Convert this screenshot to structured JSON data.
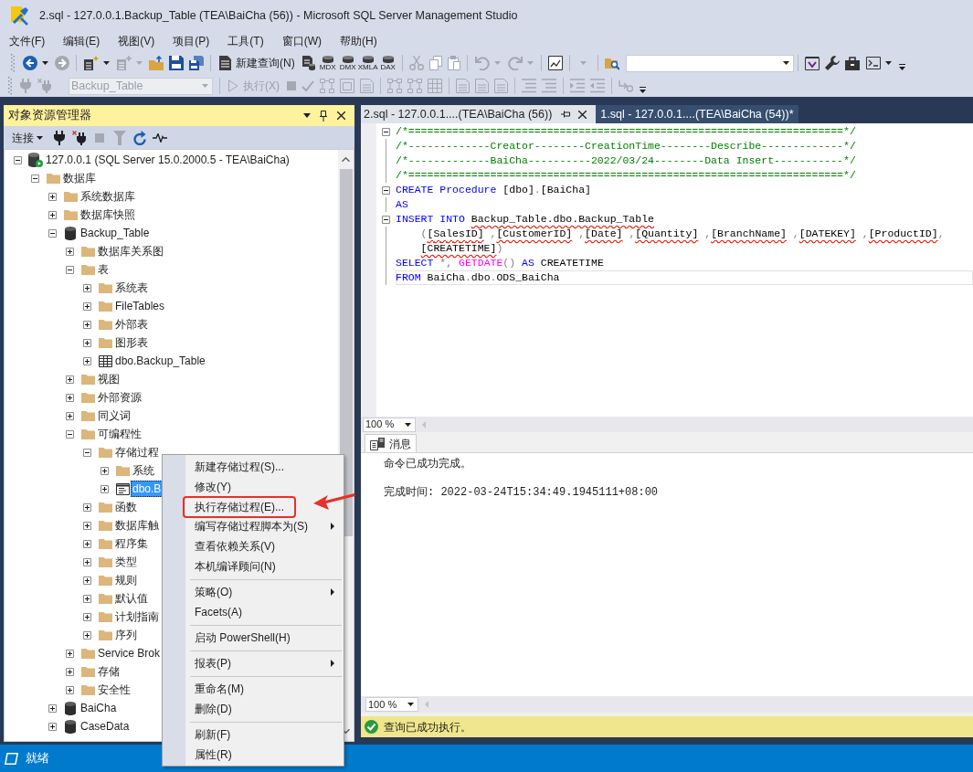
{
  "window": {
    "title": "2.sql - 127.0.0.1.Backup_Table (TEA\\BaiCha (56)) - Microsoft SQL Server Management Studio"
  },
  "menu_bar": [
    "文件(F)",
    "编辑(E)",
    "视图(V)",
    "项目(P)",
    "工具(T)",
    "窗口(W)",
    "帮助(H)"
  ],
  "toolbar_1": [
    {
      "kind": "icon",
      "dropdown": true,
      "disabled": false
    },
    {
      "kind": "icon",
      "dropdown": false,
      "disabled": true
    },
    {
      "kind": "separator"
    },
    {
      "kind": "icon",
      "dropdown": true,
      "disabled": false
    },
    {
      "kind": "icon",
      "dropdown": true,
      "disabled": true
    },
    {
      "kind": "icon",
      "dropdown": false,
      "disabled": false
    },
    {
      "kind": "icon",
      "dropdown": false,
      "disabled": false
    },
    {
      "kind": "icon",
      "dropdown": false,
      "disabled": false
    },
    {
      "kind": "separator"
    },
    {
      "kind": "text",
      "label": "新建查询(N)",
      "disabled": false
    },
    {
      "kind": "icon",
      "dropdown": false,
      "disabled": false
    },
    {
      "kind": "query",
      "label": "MDX",
      "disabled": false
    },
    {
      "kind": "query",
      "label": "DMX",
      "disabled": false
    },
    {
      "kind": "query",
      "label": "XMLA",
      "disabled": false
    },
    {
      "kind": "query",
      "label": "DAX",
      "disabled": false
    },
    {
      "kind": "separator"
    },
    {
      "kind": "icon",
      "dropdown": false,
      "disabled": true
    },
    {
      "kind": "icon",
      "dropdown": false,
      "disabled": true
    },
    {
      "kind": "icon",
      "dropdown": false,
      "disabled": true
    },
    {
      "kind": "separator"
    },
    {
      "kind": "icon",
      "dropdown": true,
      "disabled": true
    },
    {
      "kind": "icon",
      "dropdown": true,
      "disabled": true
    },
    {
      "kind": "separator"
    },
    {
      "kind": "icon",
      "dropdown": false,
      "disabled": false
    },
    {
      "kind": "separator"
    },
    {
      "kind": "caret",
      "disabled": true
    },
    {
      "kind": "separator"
    },
    {
      "kind": "icon",
      "dropdown": false,
      "disabled": false
    },
    {
      "kind": "combo",
      "disabled": false
    },
    {
      "kind": "separator"
    },
    {
      "kind": "icon",
      "dropdown": false,
      "disabled": false
    },
    {
      "kind": "icon",
      "dropdown": false,
      "disabled": false
    },
    {
      "kind": "icon",
      "dropdown": false,
      "disabled": false
    },
    {
      "kind": "icon",
      "dropdown": true,
      "disabled": false
    }
  ],
  "toolbar_2": [
    {
      "kind": "icon",
      "dropdown": false,
      "disabled": true
    },
    {
      "kind": "icon",
      "dropdown": false,
      "disabled": true
    },
    {
      "kind": "combo",
      "value": "Backup_Table",
      "disabled": true
    },
    {
      "kind": "separator"
    },
    {
      "kind": "text",
      "label": "执行(X)",
      "disabled": true
    },
    {
      "kind": "icon",
      "dropdown": false,
      "disabled": true
    },
    {
      "kind": "icon",
      "dropdown": false,
      "disabled": true
    },
    {
      "kind": "icon",
      "dropdown": false,
      "disabled": true
    },
    {
      "kind": "icon",
      "dropdown": false,
      "disabled": true
    },
    {
      "kind": "icon",
      "dropdown": false,
      "disabled": true
    },
    {
      "kind": "separator"
    },
    {
      "kind": "icon",
      "dropdown": false,
      "disabled": true
    },
    {
      "kind": "icon",
      "dropdown": false,
      "disabled": true
    },
    {
      "kind": "icon",
      "dropdown": false,
      "disabled": true
    },
    {
      "kind": "separator"
    },
    {
      "kind": "icon",
      "dropdown": false,
      "disabled": true
    },
    {
      "kind": "icon",
      "dropdown": false,
      "disabled": true
    },
    {
      "kind": "icon",
      "dropdown": false,
      "disabled": true
    },
    {
      "kind": "separator"
    },
    {
      "kind": "icon",
      "dropdown": false,
      "disabled": true
    },
    {
      "kind": "icon",
      "dropdown": false,
      "disabled": true
    },
    {
      "kind": "separator"
    },
    {
      "kind": "icon",
      "dropdown": false,
      "disabled": true
    },
    {
      "kind": "icon",
      "dropdown": false,
      "disabled": true
    },
    {
      "kind": "separator"
    },
    {
      "kind": "icon",
      "dropdown": false,
      "disabled": true
    }
  ],
  "object_explorer": {
    "title": "对象资源管理器",
    "connect": "连接",
    "buttons": [
      {
        "disabled": false
      },
      {
        "disabled": false
      },
      {
        "disabled": true
      },
      {
        "disabled": true
      },
      {
        "disabled": false
      },
      {
        "disabled": false
      }
    ],
    "tree": [
      {
        "label": "127.0.0.1 (SQL Server 15.0.2000.5 - TEA\\BaiCha)",
        "kind": "server",
        "expanded": true,
        "selected": false,
        "children": [
          {
            "label": "数据库",
            "kind": "folder",
            "expanded": true,
            "selected": false,
            "children": [
              {
                "label": "系统数据库",
                "kind": "folder",
                "expanded": false,
                "selected": false
              },
              {
                "label": "数据库快照",
                "kind": "folder",
                "expanded": false,
                "selected": false
              },
              {
                "label": "Backup_Table",
                "kind": "database",
                "expanded": true,
                "selected": false,
                "children": [
                  {
                    "label": "数据库关系图",
                    "kind": "folder",
                    "expanded": false,
                    "selected": false
                  },
                  {
                    "label": "表",
                    "kind": "folder",
                    "expanded": true,
                    "selected": false,
                    "children": [
                      {
                        "label": "系统表",
                        "kind": "folder",
                        "expanded": false,
                        "selected": false
                      },
                      {
                        "label": "FileTables",
                        "kind": "folder",
                        "expanded": false,
                        "selected": false
                      },
                      {
                        "label": "外部表",
                        "kind": "folder",
                        "expanded": false,
                        "selected": false
                      },
                      {
                        "label": "图形表",
                        "kind": "folder",
                        "expanded": false,
                        "selected": false
                      },
                      {
                        "label": "dbo.Backup_Table",
                        "kind": "table",
                        "expanded": false,
                        "selected": false
                      }
                    ]
                  },
                  {
                    "label": "视图",
                    "kind": "folder",
                    "expanded": false,
                    "selected": false
                  },
                  {
                    "label": "外部资源",
                    "kind": "folder",
                    "expanded": false,
                    "selected": false
                  },
                  {
                    "label": "同义词",
                    "kind": "folder",
                    "expanded": false,
                    "selected": false
                  },
                  {
                    "label": "可编程性",
                    "kind": "folder",
                    "expanded": true,
                    "selected": false,
                    "children": [
                      {
                        "label": "存储过程",
                        "kind": "folder",
                        "expanded": true,
                        "selected": false,
                        "children": [
                          {
                            "label": "系统",
                            "kind": "folder",
                            "expanded": false,
                            "selected": false
                          },
                          {
                            "label": "dbo.B",
                            "kind": "procedure",
                            "expanded": false,
                            "selected": true
                          }
                        ]
                      },
                      {
                        "label": "函数",
                        "kind": "folder",
                        "expanded": false,
                        "selected": false
                      },
                      {
                        "label": "数据库触",
                        "kind": "folder",
                        "expanded": false,
                        "selected": false
                      },
                      {
                        "label": "程序集",
                        "kind": "folder",
                        "expanded": false,
                        "selected": false
                      },
                      {
                        "label": "类型",
                        "kind": "folder",
                        "expanded": false,
                        "selected": false
                      },
                      {
                        "label": "规则",
                        "kind": "folder",
                        "expanded": false,
                        "selected": false
                      },
                      {
                        "label": "默认值",
                        "kind": "folder",
                        "expanded": false,
                        "selected": false
                      },
                      {
                        "label": "计划指南",
                        "kind": "folder",
                        "expanded": false,
                        "selected": false
                      },
                      {
                        "label": "序列",
                        "kind": "folder",
                        "expanded": false,
                        "selected": false
                      }
                    ]
                  },
                  {
                    "label": "Service Brok",
                    "kind": "folder",
                    "expanded": false,
                    "selected": false
                  },
                  {
                    "label": "存储",
                    "kind": "folder",
                    "expanded": false,
                    "selected": false
                  },
                  {
                    "label": "安全性",
                    "kind": "folder",
                    "expanded": false,
                    "selected": false
                  }
                ]
              },
              {
                "label": "BaiCha",
                "kind": "database",
                "expanded": false,
                "selected": false
              },
              {
                "label": "CaseData",
                "kind": "database",
                "expanded": false,
                "selected": false
              }
            ]
          }
        ]
      }
    ]
  },
  "editor_tabs": [
    {
      "label": "2.sql - 127.0.0.1....(TEA\\BaiCha (56))",
      "selected": true
    },
    {
      "label": "1.sql - 127.0.0.1....(TEA\\BaiCha (54))*",
      "selected": false
    }
  ],
  "editor": {
    "lines": [
      {
        "fold": true,
        "current": false,
        "indented": false,
        "tokens": [
          {
            "kind": "comment",
            "text": "/*=====================================================================*/"
          }
        ]
      },
      {
        "fold": false,
        "current": false,
        "indented": false,
        "tokens": [
          {
            "kind": "comment",
            "text": "/*-------------Creator--------CreationTime--------Describe-------------*/"
          }
        ]
      },
      {
        "fold": false,
        "current": false,
        "indented": false,
        "tokens": [
          {
            "kind": "comment",
            "text": "/*-------------BaiCha----------2022/03/24--------Data Insert-----------*/"
          }
        ]
      },
      {
        "fold": false,
        "current": false,
        "indented": false,
        "tokens": [
          {
            "kind": "comment",
            "text": "/*=====================================================================*/"
          }
        ]
      },
      {
        "fold": true,
        "current": false,
        "indented": false,
        "tokens": [
          {
            "kind": "keyword",
            "text": "CREATE Procedure"
          },
          {
            "kind": "plain",
            "text": " [dbo]"
          },
          {
            "kind": "operator",
            "text": "."
          },
          {
            "kind": "plain",
            "text": "[BaiCha]"
          }
        ]
      },
      {
        "fold": false,
        "current": false,
        "indented": false,
        "tokens": [
          {
            "kind": "keyword",
            "text": "AS"
          }
        ]
      },
      {
        "fold": true,
        "current": false,
        "indented": false,
        "tokens": [
          {
            "kind": "keyword",
            "text": "INSERT INTO "
          },
          {
            "kind": "error",
            "text": "Backup_Table.dbo.Backup_Table"
          }
        ]
      },
      {
        "fold": false,
        "current": false,
        "indented": true,
        "tokens": [
          {
            "kind": "operator",
            "text": "("
          },
          {
            "kind": "error",
            "text": "[SalesID]"
          },
          {
            "kind": "operator",
            "text": " ,"
          },
          {
            "kind": "error",
            "text": "[CustomerID]"
          },
          {
            "kind": "operator",
            "text": " ,"
          },
          {
            "kind": "error",
            "text": "[Date]"
          },
          {
            "kind": "operator",
            "text": " ,"
          },
          {
            "kind": "error",
            "text": "[Quantity]"
          },
          {
            "kind": "operator",
            "text": " ,"
          },
          {
            "kind": "error",
            "text": "[BranchName]"
          },
          {
            "kind": "operator",
            "text": " ,"
          },
          {
            "kind": "error",
            "text": "[DATEKEY]"
          },
          {
            "kind": "operator",
            "text": " ,"
          },
          {
            "kind": "error",
            "text": "[ProductID]"
          },
          {
            "kind": "operator",
            "text": ","
          }
        ]
      },
      {
        "fold": false,
        "current": false,
        "indented": true,
        "tokens": [
          {
            "kind": "error",
            "text": "[CREATETIME]"
          },
          {
            "kind": "operator",
            "text": ")"
          }
        ]
      },
      {
        "fold": false,
        "current": false,
        "indented": false,
        "tokens": [
          {
            "kind": "keyword",
            "text": "SELECT"
          },
          {
            "kind": "operator",
            "text": " *,"
          },
          {
            "kind": "function",
            "text": " GETDATE"
          },
          {
            "kind": "operator",
            "text": "()"
          },
          {
            "kind": "keyword",
            "text": " AS"
          },
          {
            "kind": "plain",
            "text": " CREATETIME"
          }
        ]
      },
      {
        "fold": false,
        "current": true,
        "indented": false,
        "tokens": [
          {
            "kind": "keyword",
            "text": "FROM"
          },
          {
            "kind": "plain",
            "text": " BaiCha"
          },
          {
            "kind": "operator",
            "text": "."
          },
          {
            "kind": "plain",
            "text": "dbo"
          },
          {
            "kind": "operator",
            "text": "."
          },
          {
            "kind": "plain",
            "text": "ODS_BaiCha"
          }
        ]
      }
    ],
    "zoom": "100 %"
  },
  "results": {
    "tabs": [
      {
        "label": "消息",
        "selected": true
      }
    ],
    "messages": [
      "命令已成功完成。",
      "完成时间: 2022-03-24T15:34:49.1945111+08:00"
    ],
    "zoom": "100 %"
  },
  "query_status": {
    "success": true,
    "text": "查询已成功执行。"
  },
  "status_bar": {
    "text": "就绪"
  },
  "context_menu": {
    "items": [
      {
        "kind": "item",
        "label": "新建存储过程(S)...",
        "submenu": false,
        "highlighted": false
      },
      {
        "kind": "item",
        "label": "修改(Y)",
        "submenu": false,
        "highlighted": false
      },
      {
        "kind": "item",
        "label": "执行存储过程(E)...",
        "submenu": false,
        "highlighted": true
      },
      {
        "kind": "item",
        "label": "编写存储过程脚本为(S)",
        "submenu": true,
        "highlighted": false
      },
      {
        "kind": "item",
        "label": "查看依赖关系(V)",
        "submenu": false,
        "highlighted": false
      },
      {
        "kind": "item",
        "label": "本机编译顾问(N)",
        "submenu": false,
        "highlighted": false
      },
      {
        "kind": "separator"
      },
      {
        "kind": "item",
        "label": "策略(O)",
        "submenu": true,
        "highlighted": false
      },
      {
        "kind": "item",
        "label": "Facets(A)",
        "submenu": false,
        "highlighted": false
      },
      {
        "kind": "separator"
      },
      {
        "kind": "item",
        "label": "启动 PowerShell(H)",
        "submenu": false,
        "highlighted": false
      },
      {
        "kind": "separator"
      },
      {
        "kind": "item",
        "label": "报表(P)",
        "submenu": true,
        "highlighted": false
      },
      {
        "kind": "separator"
      },
      {
        "kind": "item",
        "label": "重命名(M)",
        "submenu": false,
        "highlighted": false
      },
      {
        "kind": "item",
        "label": "删除(D)",
        "submenu": false,
        "highlighted": false
      },
      {
        "kind": "separator"
      },
      {
        "kind": "item",
        "label": "刷新(F)",
        "submenu": false,
        "highlighted": false
      },
      {
        "kind": "item",
        "label": "属性(R)",
        "submenu": false,
        "highlighted": false
      }
    ]
  }
}
